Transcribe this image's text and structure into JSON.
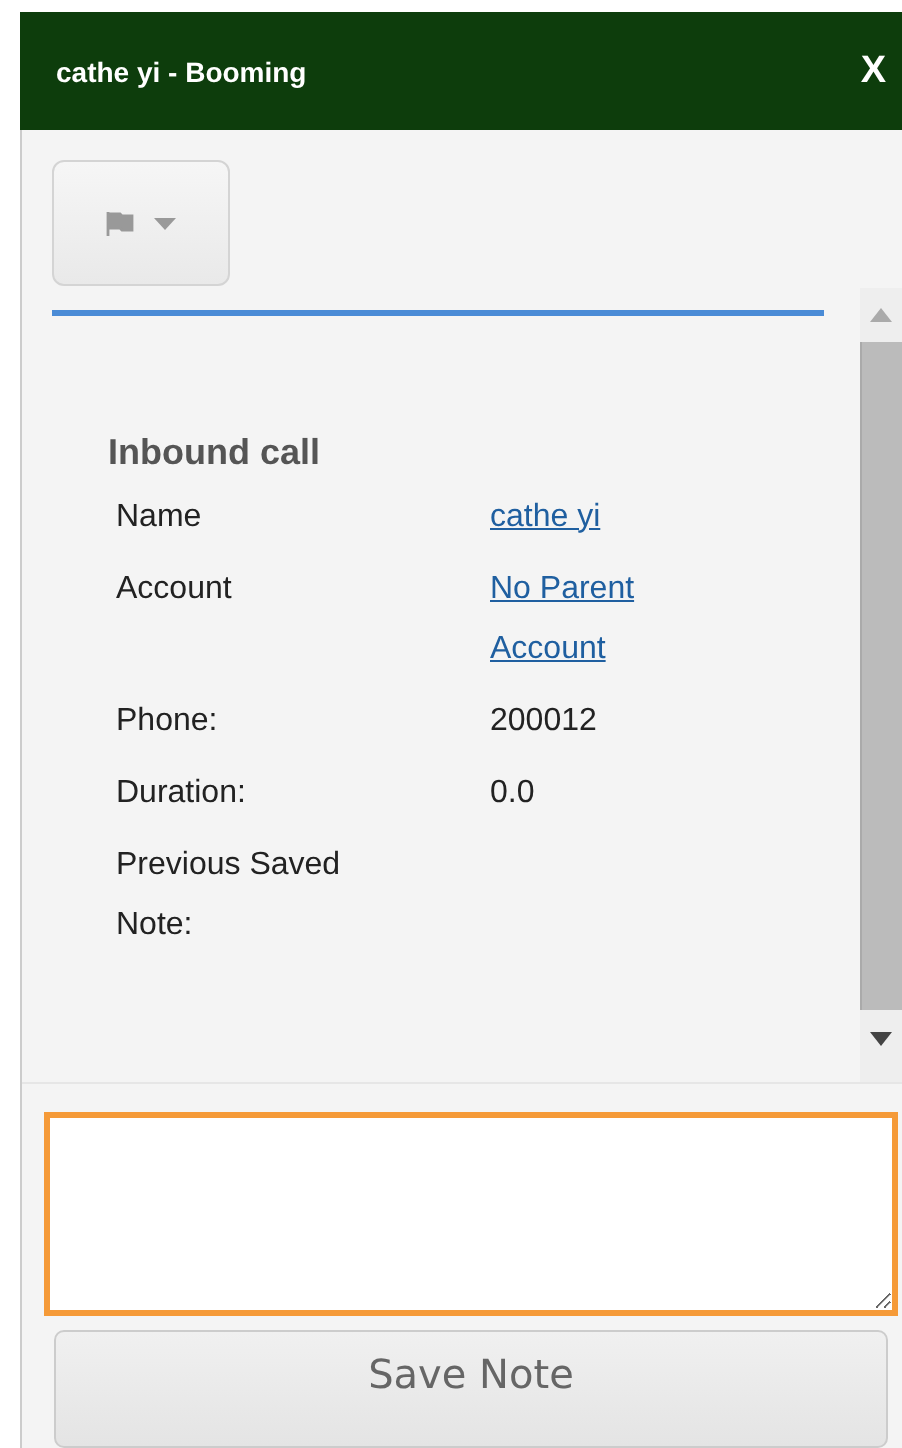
{
  "window": {
    "title": "cathe yi - Booming",
    "close": "X"
  },
  "heading": "Inbound call",
  "fields": [
    {
      "label": "Name",
      "value": "cathe yi",
      "kind": "link"
    },
    {
      "label": "Account",
      "value": "No Parent Account",
      "kind": "link"
    },
    {
      "label": "Phone:",
      "value": "200012",
      "kind": "text"
    },
    {
      "label": "Duration:",
      "value": "0.0",
      "kind": "text"
    },
    {
      "label": "Previous Saved Note:",
      "kind": "empty"
    }
  ],
  "note": {
    "focused": true
  },
  "save_button": "Save Note"
}
